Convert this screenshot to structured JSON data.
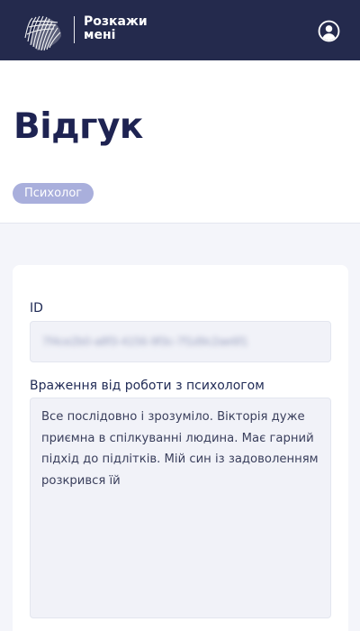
{
  "header": {
    "logo_line1": "Розкажи",
    "logo_line2": "мені",
    "logo_icon": "brain-lines-logo",
    "profile_icon": "user-circle-icon",
    "background_color": "#242a4d"
  },
  "page": {
    "title": "Відгук",
    "badge": "Психолог"
  },
  "form": {
    "id_label": "ID",
    "id_value": "7f4ce2b0-a8f3-4156-9f3c-7f1d9c2ae6f1",
    "impression_label": "Враження від роботи з психологом",
    "impression_text": "Все послідовно і зрозуміло. Вікторія дуже приємна в спілкуванні людина. Має гарний підхід до підлітків. Мій син із задоволенням розкрився їй"
  },
  "colors": {
    "accent": "#1e2352",
    "badge_bg": "#a9afdc",
    "field_bg": "#f1f2f8",
    "page_bg": "#f4f5fa"
  }
}
